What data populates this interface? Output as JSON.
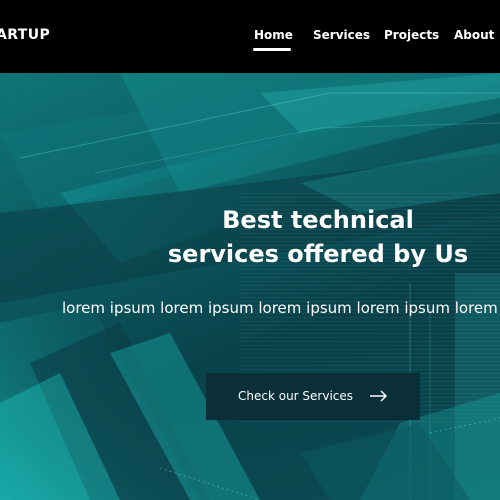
{
  "navbar": {
    "brand": "ARTUP",
    "items": [
      {
        "label": "Home",
        "active": true
      },
      {
        "label": "Services"
      },
      {
        "label": "Projects"
      },
      {
        "label": "About"
      }
    ]
  },
  "hero": {
    "title_line1": "Best technical",
    "title_line2": "services offered by Us",
    "subtitle": "lorem ipsum lorem ipsum lorem ipsum lorem ipsum lorem ipsum lore",
    "cta_label": "Check our Services",
    "cta_icon": "arrow-right-icon"
  },
  "colors": {
    "nav_background": "#000000",
    "hero_teal": "#0b4f57",
    "button_background": "#0a2f38",
    "text": "#ffffff"
  }
}
